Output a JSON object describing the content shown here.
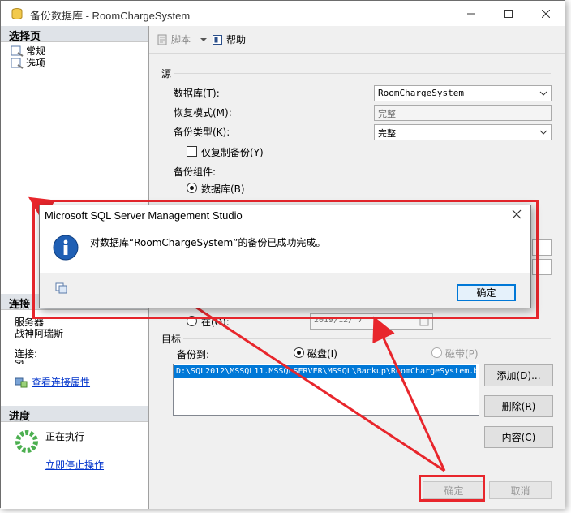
{
  "window": {
    "title": "备份数据库 - RoomChargeSystem"
  },
  "left": {
    "select_page_header": "选择页",
    "pages": [
      "常规",
      "选项"
    ],
    "connection_header": "连接",
    "server_label": "服务器",
    "server_value": "战神阿瑞斯",
    "conn_label": "连接:",
    "conn_value": "sa",
    "view_conn_props": "查看连接属性",
    "progress_header": "进度",
    "progress_status": "正在执行",
    "stop_link": "立即停止操作"
  },
  "toolbar": {
    "script_label": "脚本",
    "help_label": "帮助"
  },
  "source": {
    "group_label": "源",
    "database_label": "数据库(T):",
    "database_value": "RoomChargeSystem",
    "recovery_label": "恢复模式(M):",
    "recovery_value": "完整",
    "backup_type_label": "备份类型(K):",
    "backup_type_value": "完整",
    "copy_only_label": "仅复制备份(Y)",
    "component_label": "备份组件:",
    "component_database": "数据库(B)"
  },
  "expire": {
    "on_label": "在(O):",
    "date_value": "2019/12/ 7"
  },
  "destination": {
    "group_label": "目标",
    "backup_to_label": "备份到:",
    "disk_label": "磁盘(I)",
    "tape_label": "磁带(P)",
    "path": "D:\\SQL2012\\MSSQL11.MSSQLSERVER\\MSSQL\\Backup\\RoomChargeSystem.b",
    "add_button": "添加(D)...",
    "remove_button": "删除(R)",
    "contents_button": "内容(C)"
  },
  "footer": {
    "ok_button": "确定",
    "cancel_button": "取消"
  },
  "dialog": {
    "title": "Microsoft SQL Server Management Studio",
    "message": "对数据库“RoomChargeSystem”的备份已成功完成。",
    "ok_button": "确定"
  },
  "colors": {
    "highlight": "#e8262c",
    "selection": "#0078d7",
    "link": "#0033cc"
  }
}
